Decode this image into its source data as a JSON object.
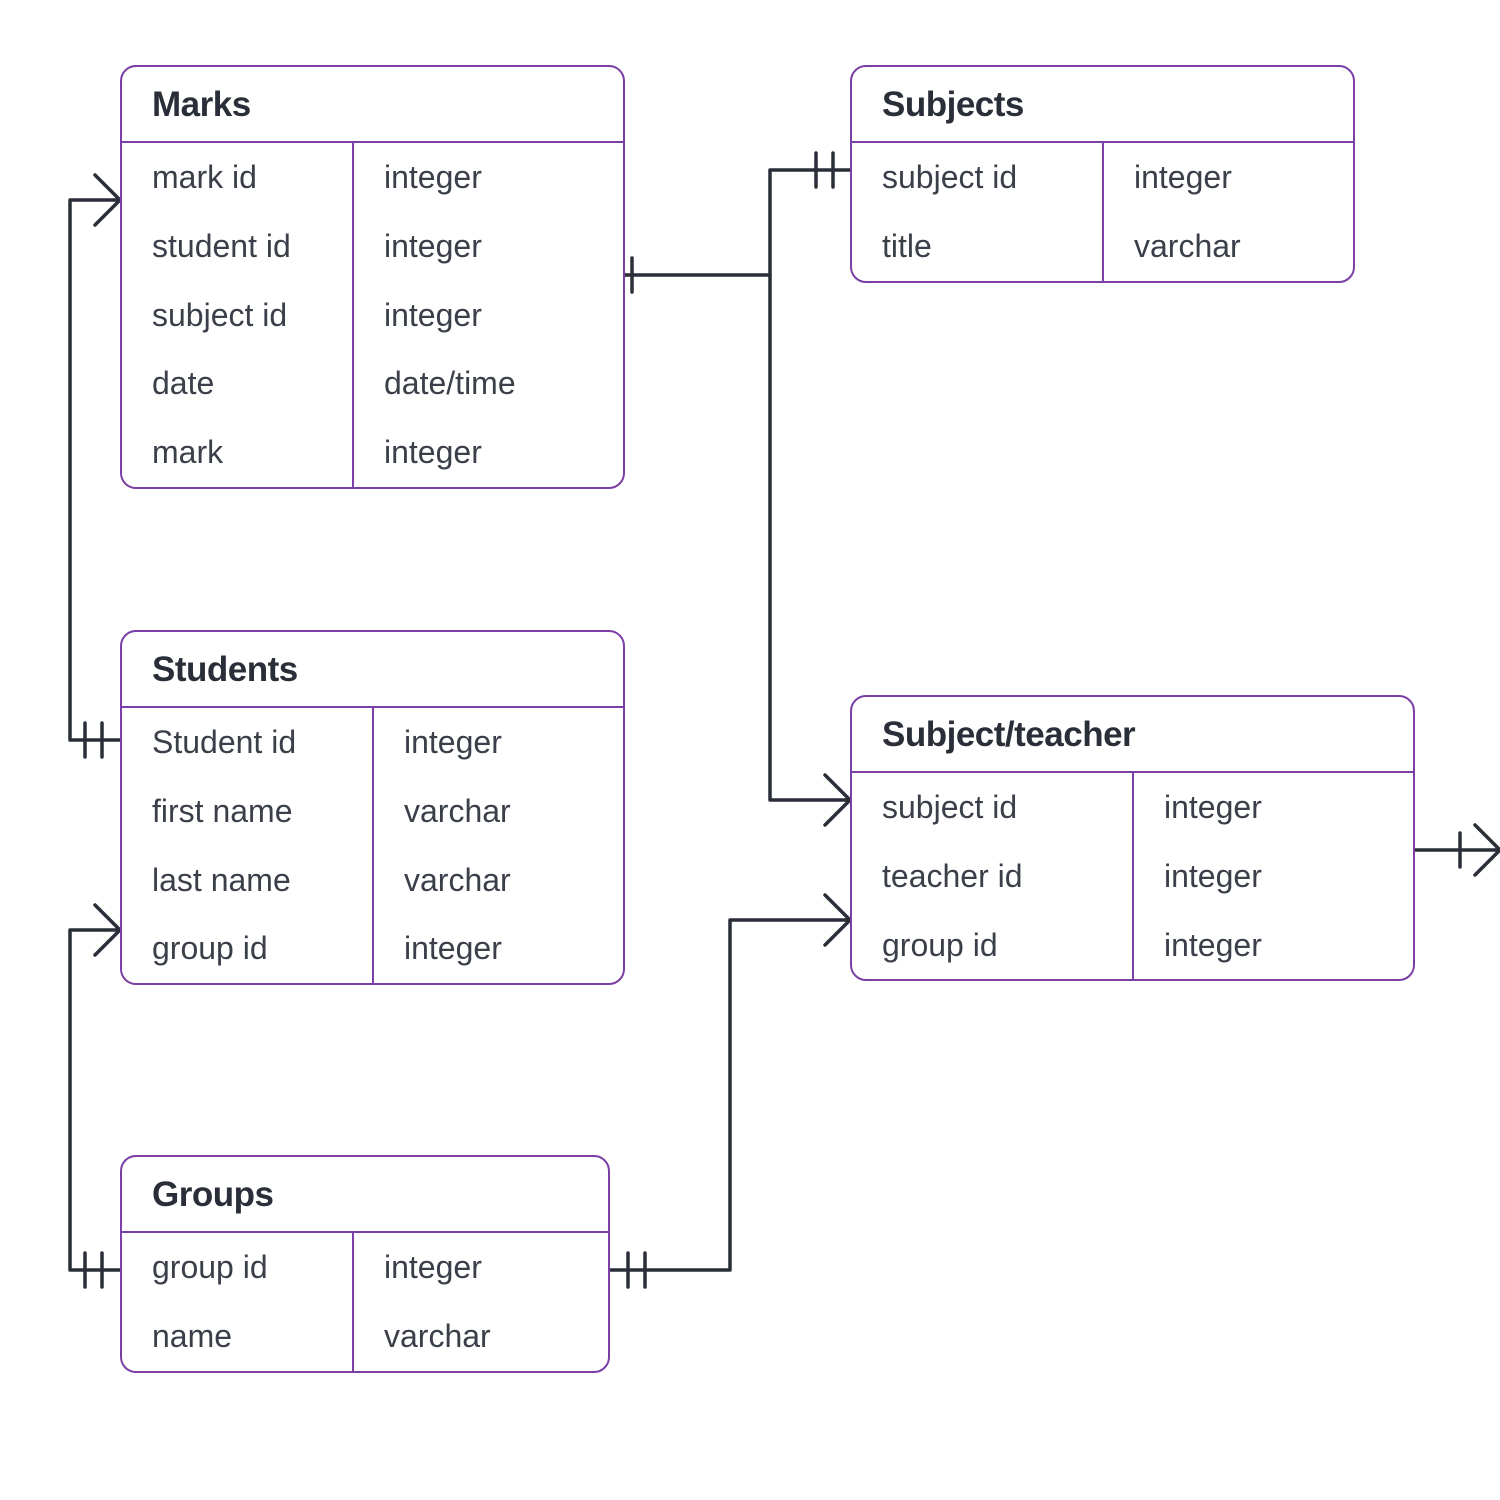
{
  "entities": {
    "marks": {
      "title": "Marks",
      "fields": [
        {
          "name": "mark id",
          "type": "integer"
        },
        {
          "name": "student id",
          "type": "integer"
        },
        {
          "name": "subject id",
          "type": "integer"
        },
        {
          "name": "date",
          "type": "date/time"
        },
        {
          "name": "mark",
          "type": "integer"
        }
      ]
    },
    "subjects": {
      "title": "Subjects",
      "fields": [
        {
          "name": "subject id",
          "type": "integer"
        },
        {
          "name": "title",
          "type": "varchar"
        }
      ]
    },
    "students": {
      "title": "Students",
      "fields": [
        {
          "name": "Student id",
          "type": "integer"
        },
        {
          "name": "first name",
          "type": "varchar"
        },
        {
          "name": "last name",
          "type": "varchar"
        },
        {
          "name": "group id",
          "type": "integer"
        }
      ]
    },
    "subject_teacher": {
      "title": "Subject/teacher",
      "fields": [
        {
          "name": "subject id",
          "type": "integer"
        },
        {
          "name": "teacher id",
          "type": "integer"
        },
        {
          "name": "group id",
          "type": "integer"
        }
      ]
    },
    "groups": {
      "title": "Groups",
      "fields": [
        {
          "name": "group id",
          "type": "integer"
        },
        {
          "name": "name",
          "type": "varchar"
        }
      ]
    }
  }
}
